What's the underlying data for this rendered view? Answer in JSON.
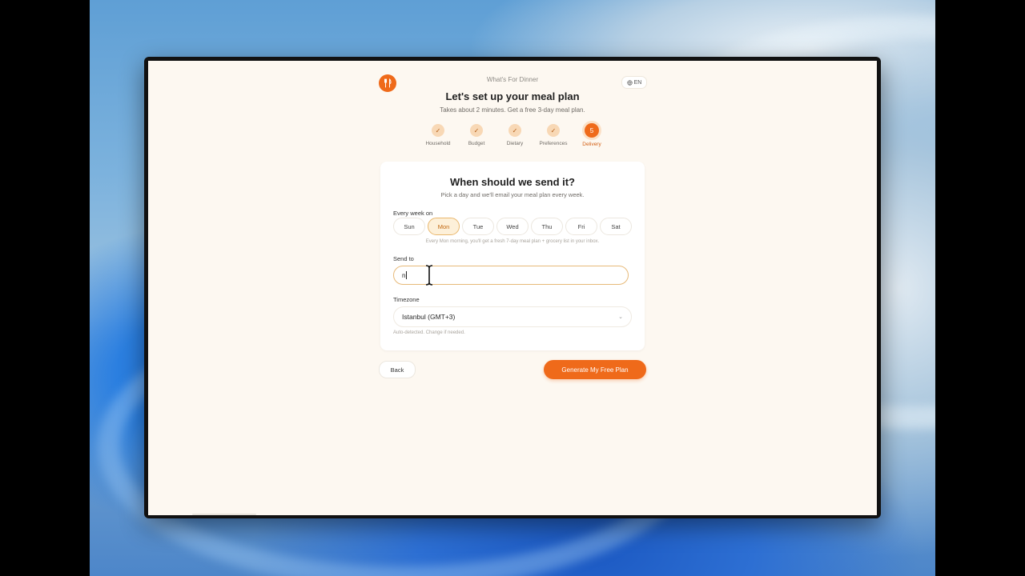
{
  "colors": {
    "accent": "#ef6a1a",
    "accent_soft": "#f8d8b5",
    "page_bg": "#fdf8f1",
    "selected_day_bg": "#fdf0d9",
    "input_border": "#e7b978"
  },
  "header": {
    "app_name": "What's For Dinner",
    "language": "EN",
    "logo_icon": "fork-knife-icon",
    "globe_icon": "globe-icon"
  },
  "intro": {
    "title": "Let's set up your meal plan",
    "subtitle": "Takes about 2 minutes. Get a free 3-day meal plan."
  },
  "steps": [
    {
      "label": "Household",
      "state": "done",
      "mark": "✓"
    },
    {
      "label": "Budget",
      "state": "done",
      "mark": "✓"
    },
    {
      "label": "Dietary",
      "state": "done",
      "mark": "✓"
    },
    {
      "label": "Preferences",
      "state": "done",
      "mark": "✓"
    },
    {
      "label": "Delivery",
      "state": "active",
      "mark": "5"
    }
  ],
  "card": {
    "title": "When should we send it?",
    "subtitle": "Pick a day and we'll email your meal plan every week.",
    "every_week_label": "Every week on",
    "days": [
      "Sun",
      "Mon",
      "Tue",
      "Wed",
      "Thu",
      "Fri",
      "Sat"
    ],
    "selected_day": "Mon",
    "day_hint": "Every Mon morning, you'll get a fresh 7-day meal plan + grocery list in your inbox.",
    "send_to_label": "Send to",
    "send_to_value": "n",
    "timezone_label": "Timezone",
    "timezone_value": "Istanbul (GMT+3)",
    "timezone_hint": "Auto-detected. Change if needed."
  },
  "actions": {
    "back_label": "Back",
    "generate_label": "Generate My Free Plan"
  }
}
